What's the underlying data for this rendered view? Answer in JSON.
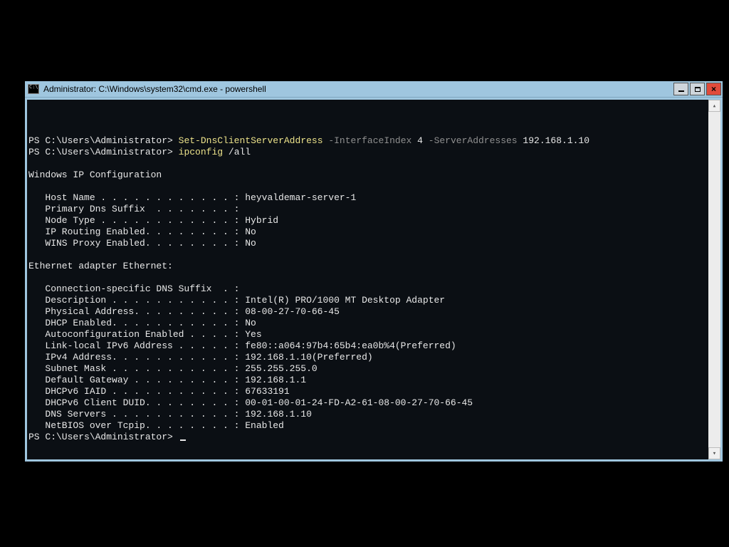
{
  "window": {
    "title": "Administrator: C:\\Windows\\system32\\cmd.exe - powershell"
  },
  "ps": {
    "prompt": "PS C:\\Users\\Administrator>",
    "cmd1": {
      "exe": "Set-DnsClientServerAddress",
      "p1": "-InterfaceIndex",
      "v1": "4",
      "p2": "-ServerAddresses",
      "v2": "192.168.1.10"
    },
    "cmd2": {
      "exe": "ipconfig",
      "arg": "/all"
    }
  },
  "out": {
    "hdr1": "Windows IP Configuration",
    "hostname_line": "   Host Name . . . . . . . . . . . . : heyvaldemar-server-1",
    "primary_dns_line": "   Primary Dns Suffix  . . . . . . . :",
    "node_type_line": "   Node Type . . . . . . . . . . . . : Hybrid",
    "ip_routing_line": "   IP Routing Enabled. . . . . . . . : No",
    "wins_proxy_line": "   WINS Proxy Enabled. . . . . . . . : No",
    "hdr2": "Ethernet adapter Ethernet:",
    "conn_suffix_line": "   Connection-specific DNS Suffix  . :",
    "description_line": "   Description . . . . . . . . . . . : Intel(R) PRO/1000 MT Desktop Adapter",
    "phys_addr_line": "   Physical Address. . . . . . . . . : 08-00-27-70-66-45",
    "dhcp_enabled_line": "   DHCP Enabled. . . . . . . . . . . : No",
    "autoconf_line": "   Autoconfiguration Enabled . . . . : Yes",
    "link_local_line": "   Link-local IPv6 Address . . . . . : fe80::a064:97b4:65b4:ea0b%4(Preferred)",
    "ipv4_line": "   IPv4 Address. . . . . . . . . . . : 192.168.1.10(Preferred)",
    "subnet_line": "   Subnet Mask . . . . . . . . . . . : 255.255.255.0",
    "gateway_line": "   Default Gateway . . . . . . . . . : 192.168.1.1",
    "iaid_line": "   DHCPv6 IAID . . . . . . . . . . . : 67633191",
    "duid_line": "   DHCPv6 Client DUID. . . . . . . . : 00-01-00-01-24-FD-A2-61-08-00-27-70-66-45",
    "dns_servers_line": "   DNS Servers . . . . . . . . . . . : 192.168.1.10",
    "netbios_line": "   NetBIOS over Tcpip. . . . . . . . : Enabled"
  }
}
